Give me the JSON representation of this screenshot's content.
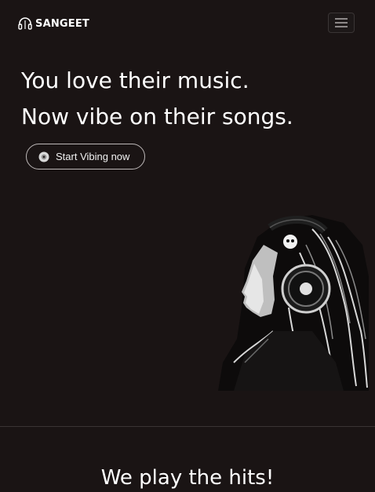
{
  "navbar": {
    "brand_text": "SANGEET",
    "brand_icon": "headphones-icon",
    "toggler_icon": "hamburger-icon"
  },
  "hero": {
    "title_line1": "You love their music.",
    "title_line2": "Now vibe on their songs.",
    "cta_label": "Start Vibing now",
    "cta_icon": "disc-icon",
    "image": "woman-with-headphones-photo"
  },
  "section": {
    "title": "We play the hits!"
  },
  "colors": {
    "background": "#1a1414",
    "text": "#ffffff",
    "button_border": "#bdb8b8"
  }
}
